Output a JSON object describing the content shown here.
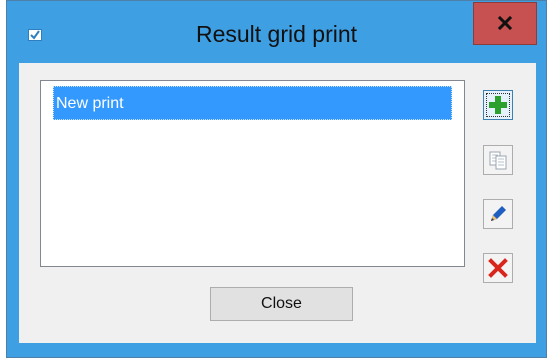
{
  "window": {
    "title": "Result grid print",
    "app_icon": "check-box-icon",
    "close_icon": "close-icon"
  },
  "list": {
    "items": [
      {
        "label": "New print",
        "selected": true
      }
    ]
  },
  "toolbar": {
    "add_icon": "plus-icon",
    "copy_icon": "copy-icon",
    "edit_icon": "pencil-icon",
    "delete_icon": "delete-x-icon"
  },
  "footer": {
    "close_label": "Close"
  },
  "colors": {
    "frame": "#3f9fe3",
    "close_button": "#c75050",
    "selection": "#3399ff",
    "client": "#f0f0f0",
    "add_green": "#2ca02c",
    "delete_red": "#d9261c",
    "edit_blue": "#1f5fbf"
  }
}
